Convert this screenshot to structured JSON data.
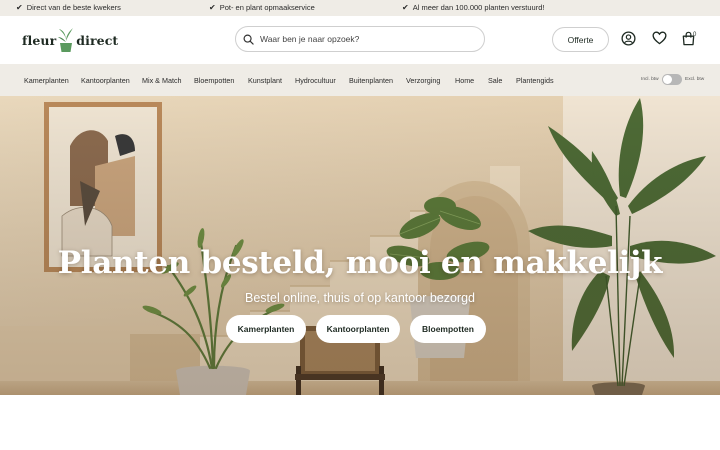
{
  "usp_bar": {
    "items": [
      "Direct van de beste kwekers",
      "Pot- en plant opmaakservice",
      "Al meer dan 100.000 planten verstuurd!"
    ]
  },
  "header": {
    "logo": {
      "word1": "fleur",
      "word2": "direct"
    },
    "search": {
      "placeholder": "Waar ben je naar opzoek?",
      "value": ""
    },
    "offerte_label": "Offerte",
    "cart_count": "0",
    "icons": [
      "account-icon",
      "heart-icon",
      "cart-icon",
      "search-icon"
    ]
  },
  "nav": {
    "items": [
      "Kamerplanten",
      "Kantoorplanten",
      "Mix & Match",
      "Bloempotten",
      "Kunstplant",
      "Hydrocultuur",
      "Buitenplanten",
      "Verzorging",
      "Home",
      "Sale",
      "Plantengids"
    ],
    "vat_left": "Incl. btw",
    "vat_right": "Excl. btw"
  },
  "hero": {
    "title": "Planten besteld, mooi en makkelijk",
    "subtitle": "Bestel online, thuis of op kantoor bezorgd",
    "buttons": [
      "Kamerplanten",
      "Kantoorplanten",
      "Bloempotten"
    ]
  },
  "colors": {
    "brand": "#1e2a22",
    "bar_bg": "#efece6",
    "logo_green": "#5a9a5e",
    "hero_wall": "#e6d3b4"
  }
}
